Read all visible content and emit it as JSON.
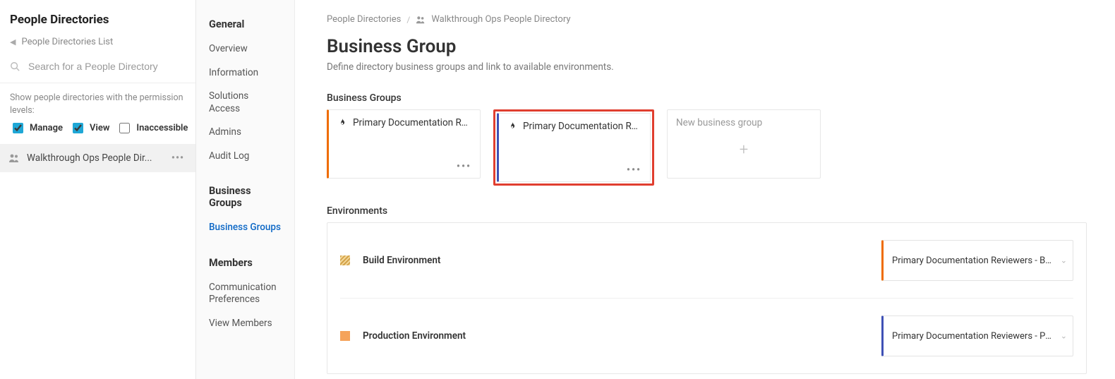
{
  "left": {
    "title": "People Directories",
    "back_label": "People Directories List",
    "search_placeholder": "Search for a People Directory",
    "filter_label": "Show people directories with the permission levels:",
    "cb_manage": "Manage",
    "cb_view": "View",
    "cb_inaccessible": "Inaccessible",
    "selected_dir": "Walkthrough Ops People Dir..."
  },
  "nav": {
    "general": "General",
    "items_general": [
      "Overview",
      "Information",
      "Solutions Access",
      "Admins",
      "Audit Log"
    ],
    "bg_section": "Business Groups",
    "bg_item": "Business Groups",
    "members_section": "Members",
    "items_members": [
      "Communication Preferences",
      "View Members"
    ]
  },
  "breadcrumb": {
    "root": "People Directories",
    "current": "Walkthrough Ops People Directory"
  },
  "page": {
    "title": "Business Group",
    "subtitle": "Define directory business groups and link to available environments."
  },
  "bg": {
    "section_label": "Business Groups",
    "cards": [
      {
        "label": "Primary Documentation Re..."
      },
      {
        "label": "Primary Documentation Re..."
      }
    ],
    "new_label": "New business group"
  },
  "env": {
    "section_label": "Environments",
    "rows": [
      {
        "name": "Build Environment",
        "select": "Primary Documentation Reviewers - BUILD"
      },
      {
        "name": "Production Environment",
        "select": "Primary Documentation Reviewers - PROD"
      }
    ]
  }
}
